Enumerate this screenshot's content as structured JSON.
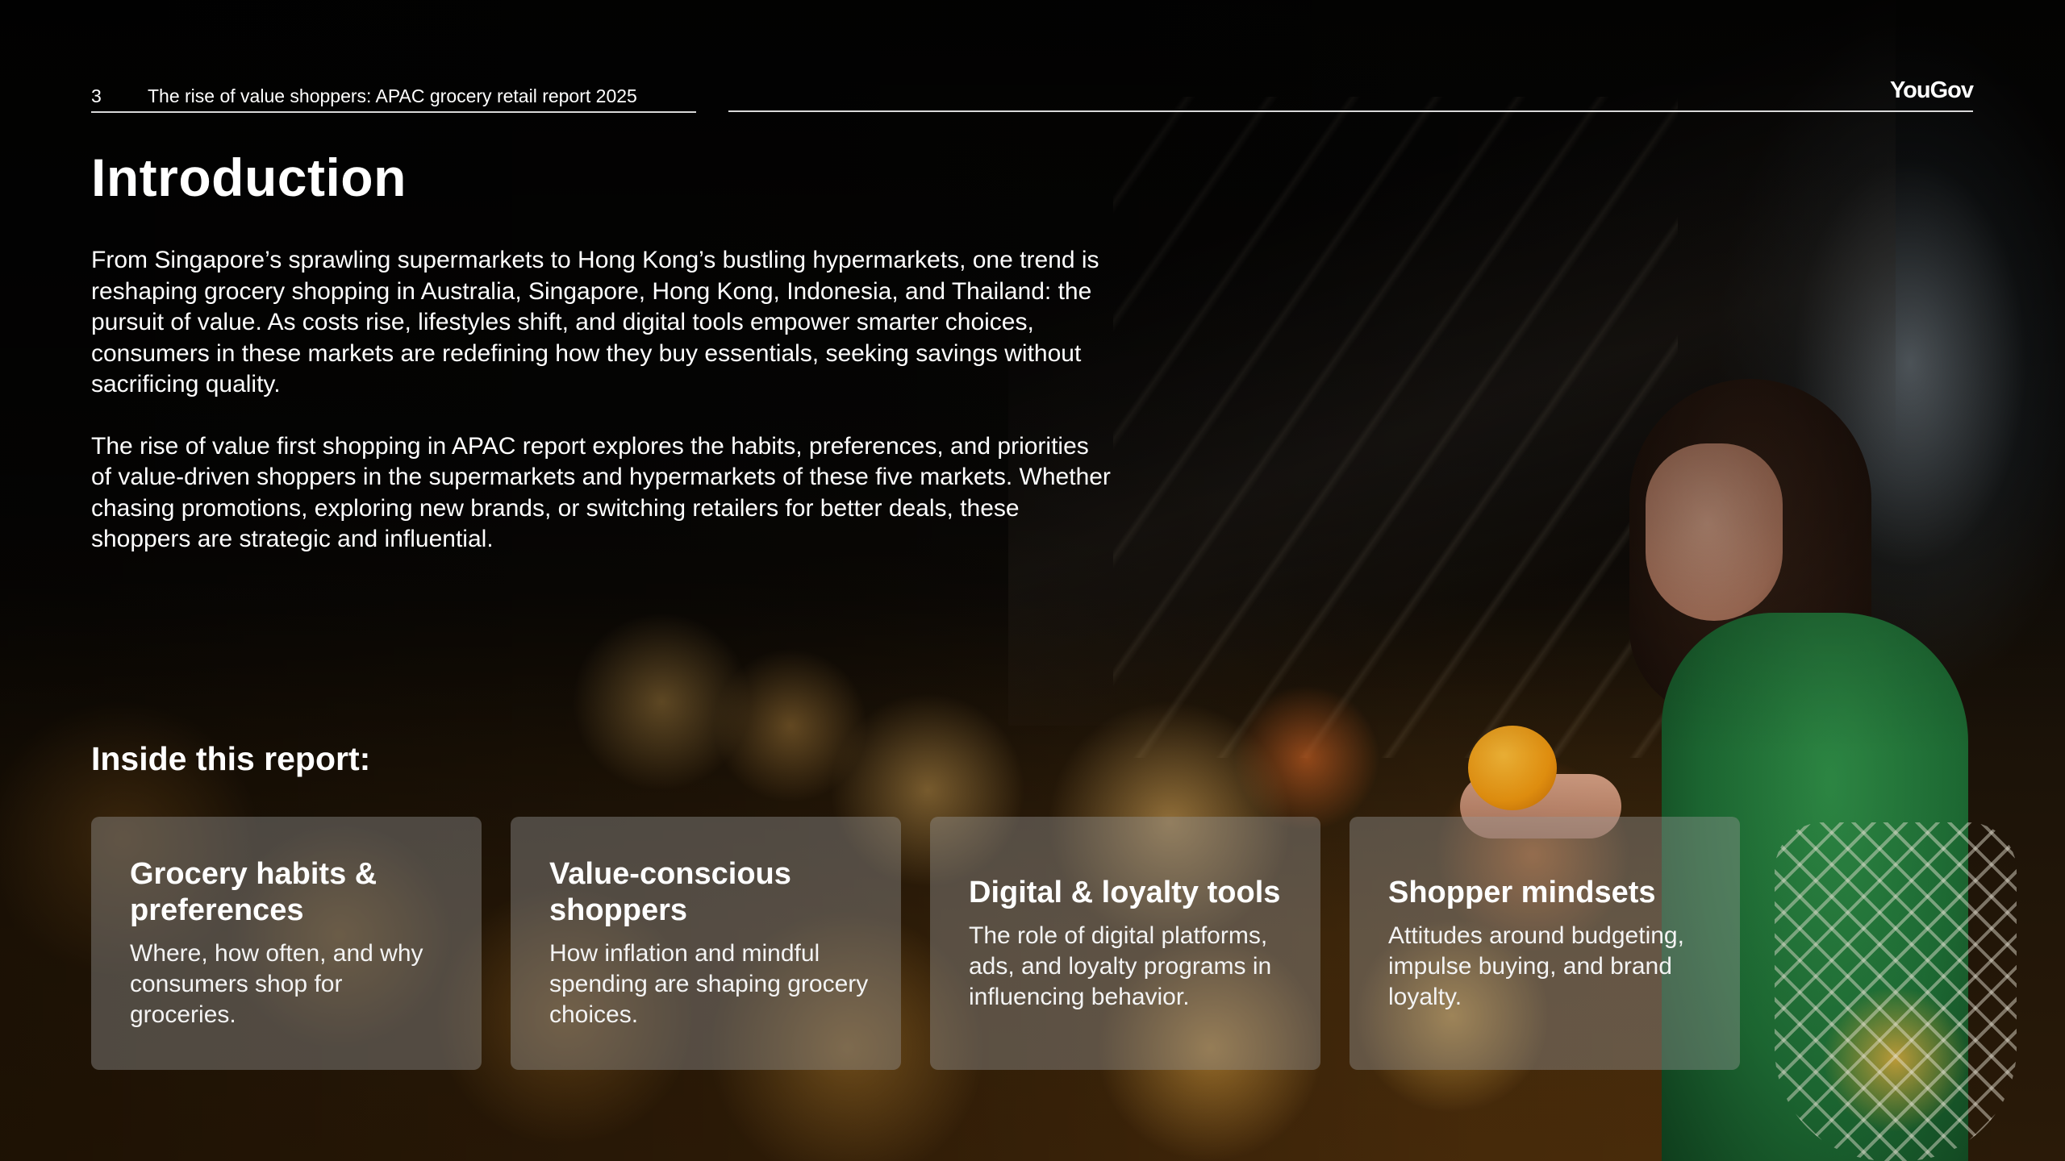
{
  "header": {
    "page_number": "3",
    "report_title": "The rise of value shoppers: APAC grocery retail report 2025",
    "brand": "YouGov"
  },
  "intro": {
    "title": "Introduction",
    "paragraphs": [
      "From Singapore’s sprawling supermarkets to Hong Kong’s bustling hypermarkets, one trend is reshaping grocery shopping in Australia, Singapore, Hong Kong, Indonesia, and Thailand: the pursuit of value. As costs rise, lifestyles shift, and digital tools empower smarter choices, consumers in these markets are redefining how they buy essentials, seeking savings without sacrificing quality.",
      "The rise of value first shopping in APAC report explores the habits, preferences, and priorities of value-driven shoppers in the supermarkets and hypermarkets of these five markets. Whether chasing promotions, exploring new brands, or switching retailers for better deals, these shoppers are strategic and influential."
    ]
  },
  "inside": {
    "heading": "Inside this report:",
    "cards": [
      {
        "title": "Grocery habits & preferences",
        "description": "Where, how often, and why consumers shop for groceries."
      },
      {
        "title": "Value-conscious shoppers",
        "description": "How inflation and mindful spending are shaping grocery choices."
      },
      {
        "title": "Digital & loyalty tools",
        "description": "The role of digital platforms, ads, and loyalty programs in influencing behavior."
      },
      {
        "title": "Shopper mindsets",
        "description": "Attitudes around budgeting, impulse buying, and brand loyalty."
      }
    ]
  },
  "colors": {
    "text": "#ffffff",
    "rule": "#d9d9d9",
    "card_background": "rgba(150,150,150,0.42)"
  }
}
